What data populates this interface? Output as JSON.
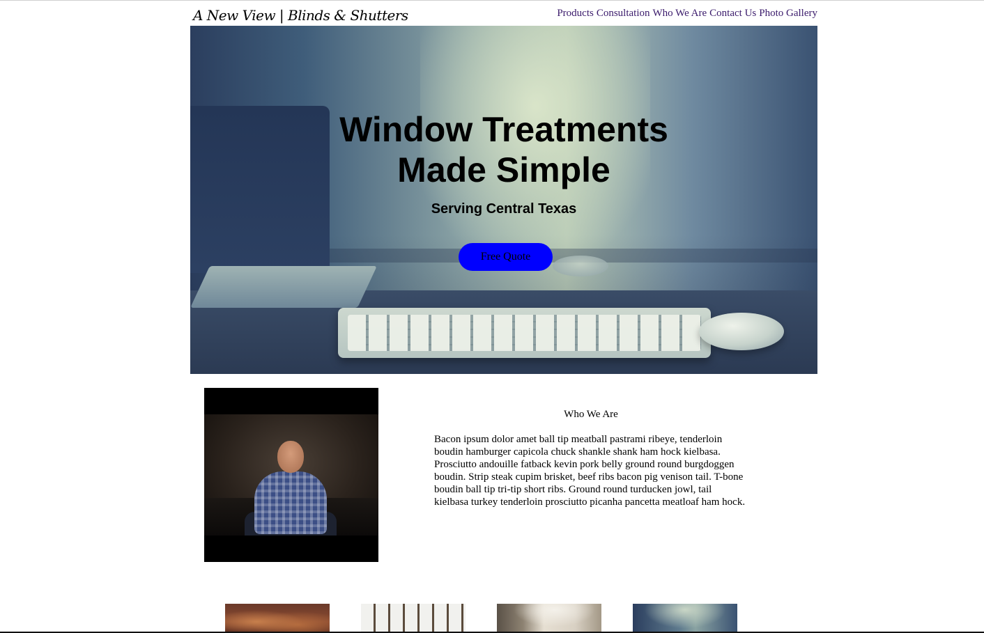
{
  "header": {
    "logo": "A New View | Blinds & Shutters",
    "nav": [
      {
        "label": "Products"
      },
      {
        "label": "Consultation"
      },
      {
        "label": "Who We Are"
      },
      {
        "label": "Contact Us"
      },
      {
        "label": "Photo Gallery"
      }
    ]
  },
  "hero": {
    "title_line1": "Window Treatments",
    "title_line2": "Made Simple",
    "subtitle": "Serving Central Texas",
    "cta_label": "Free Quote",
    "cta_color": "#0000ff"
  },
  "about": {
    "heading": "Who We Are",
    "body": "Bacon ipsum dolor amet ball tip meatball pastrami ribeye, tenderloin boudin hamburger capicola chuck shankle shank ham hock kielbasa. Prosciutto andouille fatback kevin pork belly ground round burgdoggen boudin. Strip steak cupim brisket, beef ribs bacon pig venison tail. T-bone boudin ball tip tri-tip short ribs. Ground round turducken jowl, tail kielbasa turkey tenderloin prosciutto picanha pancetta meatloaf ham hock."
  },
  "colors": {
    "nav_link": "#3a1a6b"
  }
}
